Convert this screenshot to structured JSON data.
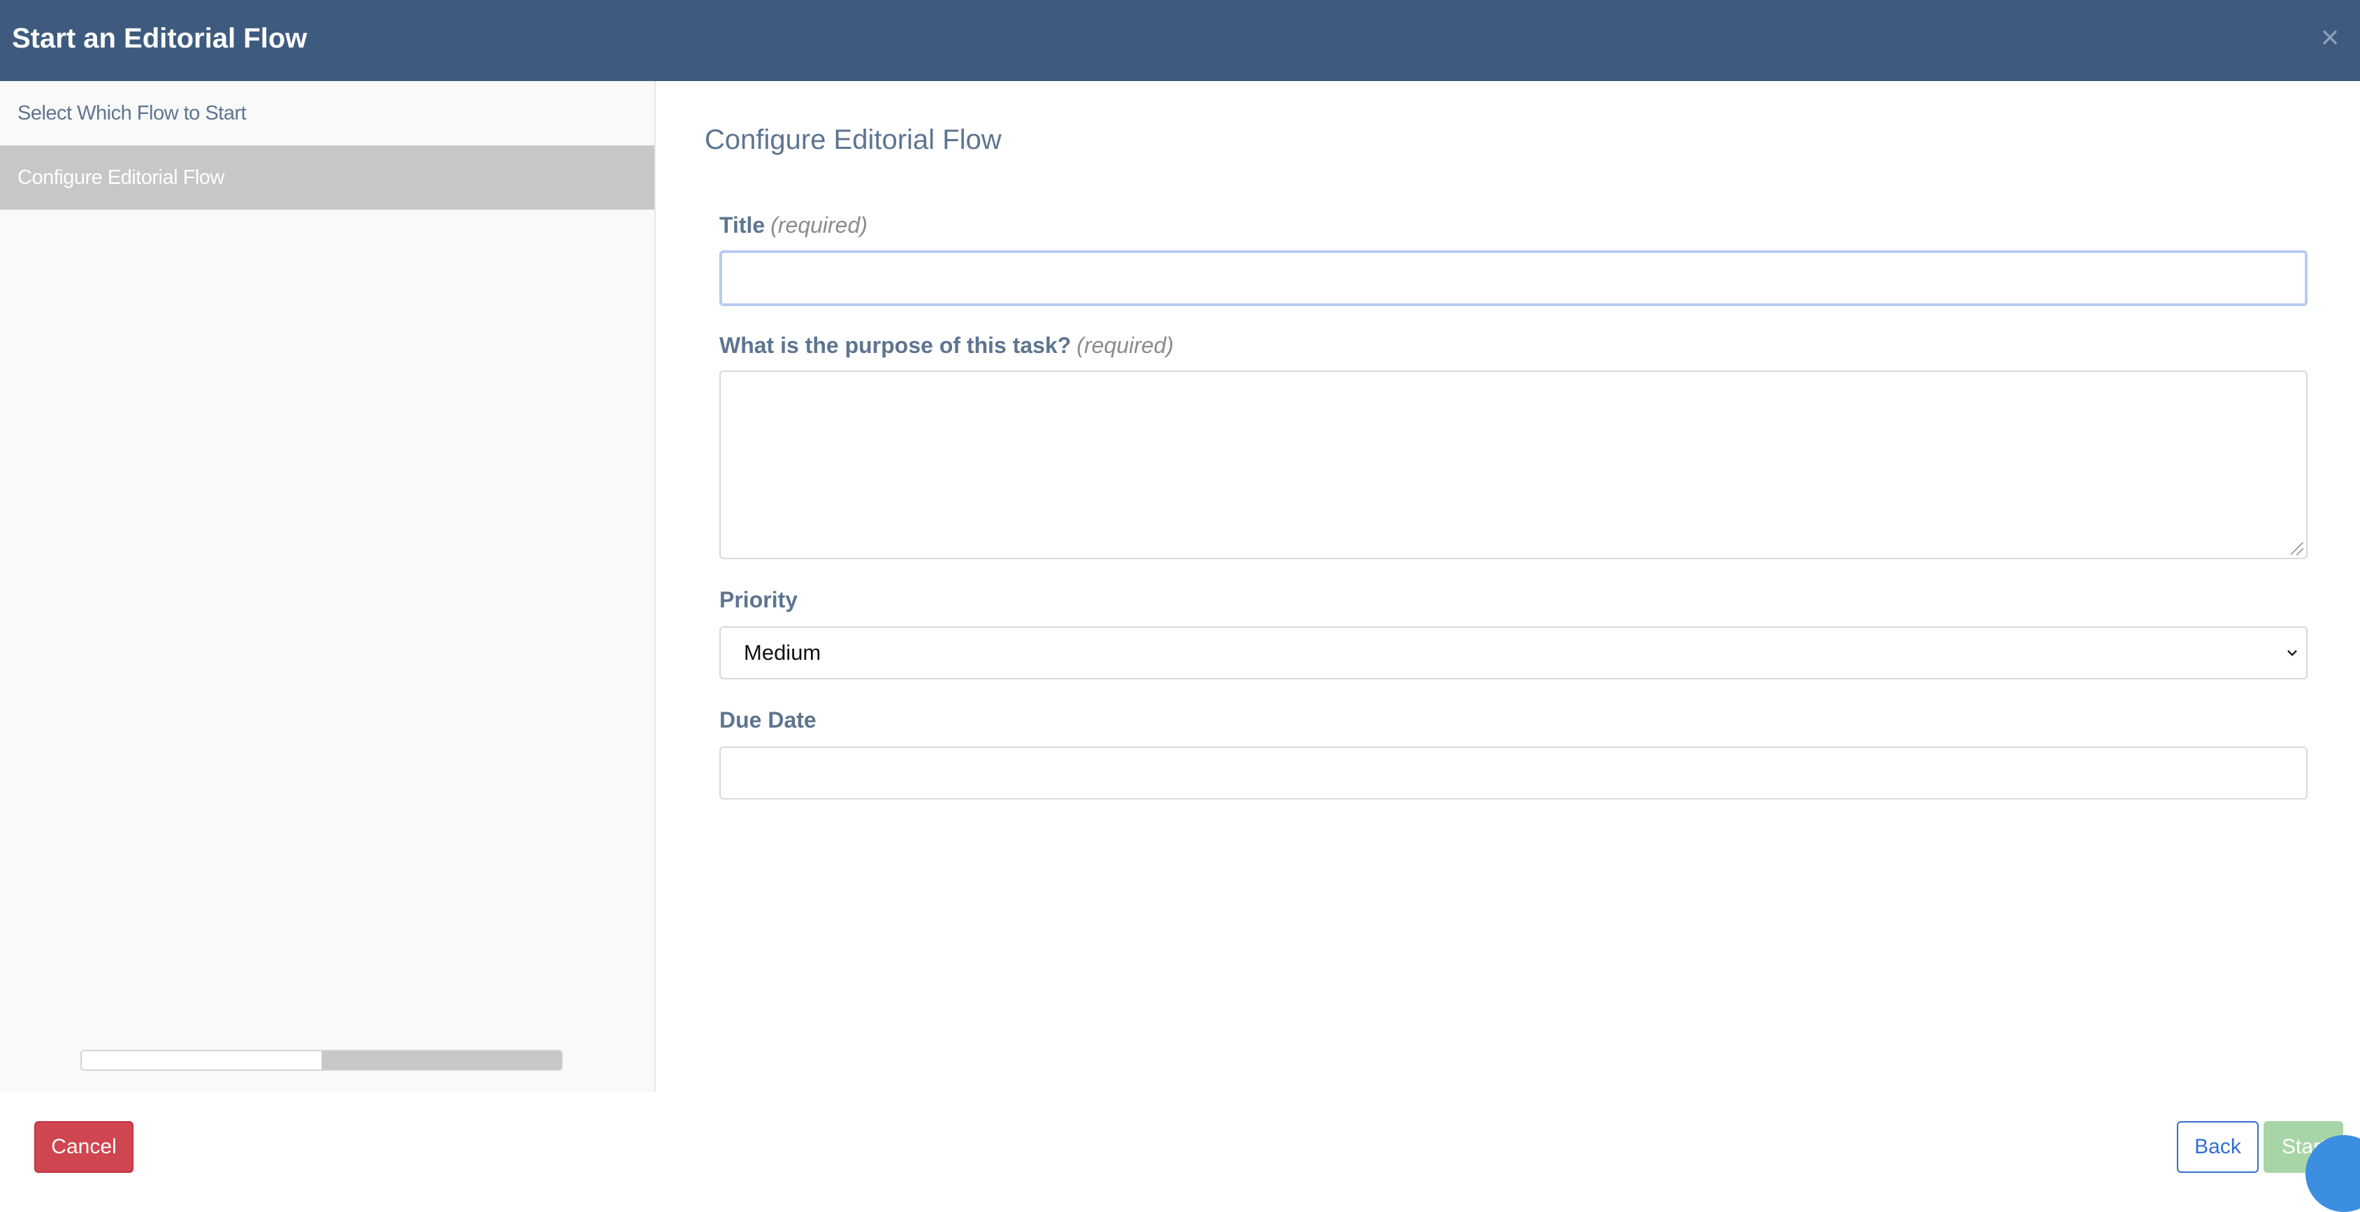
{
  "header": {
    "title": "Start an Editorial Flow",
    "close_glyph": "×"
  },
  "sidebar": {
    "items": [
      {
        "label": "Select Which Flow to Start",
        "active": false
      },
      {
        "label": "Configure Editorial Flow",
        "active": true
      }
    ],
    "progress": {
      "step": 2,
      "total": 2,
      "fill_fraction": 0.5
    }
  },
  "main": {
    "title": "Configure Editorial Flow",
    "fields": {
      "title": {
        "label": "Title",
        "required_note": "(required)",
        "value": "",
        "placeholder": ""
      },
      "purpose": {
        "label": "What is the purpose of this task?",
        "required_note": "(required)",
        "value": ""
      },
      "priority": {
        "label": "Priority",
        "selected": "Medium"
      },
      "due_date": {
        "label": "Due Date",
        "value": ""
      }
    }
  },
  "footer": {
    "cancel_label": "Cancel",
    "back_label": "Back",
    "start_label": "Start"
  },
  "colors": {
    "header_bg": "#3e5b7f",
    "cancel_bg": "#cf4550",
    "back_border": "#2f6fd0",
    "start_bg": "#a8d5a8",
    "active_step_bg": "#c7c7c7",
    "chat_bubble": "#3b8ee0"
  },
  "icons": {
    "close": "close-icon",
    "select_arrow": "chevron-down-icon",
    "chat": "chat-bubble-icon"
  }
}
